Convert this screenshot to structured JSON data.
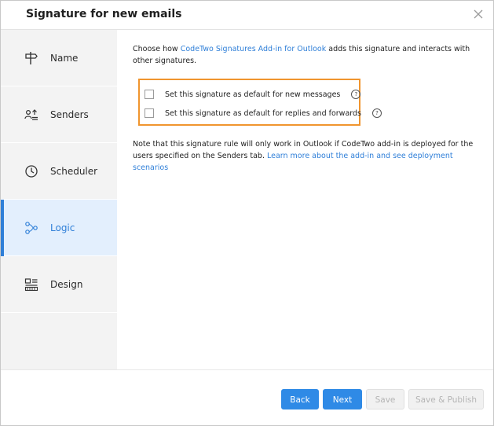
{
  "dialog": {
    "title": "Signature for new emails"
  },
  "sidebar": {
    "items": [
      {
        "label": "Name",
        "icon": "signpost-icon",
        "active": false
      },
      {
        "label": "Senders",
        "icon": "users-icon",
        "active": false
      },
      {
        "label": "Scheduler",
        "icon": "clock-icon",
        "active": false
      },
      {
        "label": "Logic",
        "icon": "logic-flow-icon",
        "active": true
      },
      {
        "label": "Design",
        "icon": "layout-icon",
        "active": false
      }
    ]
  },
  "main": {
    "intro": {
      "prefix": "Choose how ",
      "link": "CodeTwo Signatures Add-in for Outlook",
      "suffix": " adds this signature and interacts with other signatures."
    },
    "options": [
      {
        "label": "Set this signature as default for new messages",
        "checked": false
      },
      {
        "label": "Set this signature as default for replies and forwards",
        "checked": false
      }
    ],
    "note": {
      "text": "Note that this signature rule will only work in Outlook if CodeTwo add-in is deployed for the users specified on the Senders tab. ",
      "link": "Learn more about the add-in and see deployment scenarios"
    },
    "help_glyph": "?"
  },
  "footer": {
    "back": "Back",
    "next": "Next",
    "save": "Save",
    "save_publish": "Save & Publish"
  },
  "colors": {
    "accent": "#2f7fd8",
    "highlight_border": "#f0952e",
    "sidebar_bg": "#f3f3f3",
    "active_bg": "#e3effd"
  }
}
